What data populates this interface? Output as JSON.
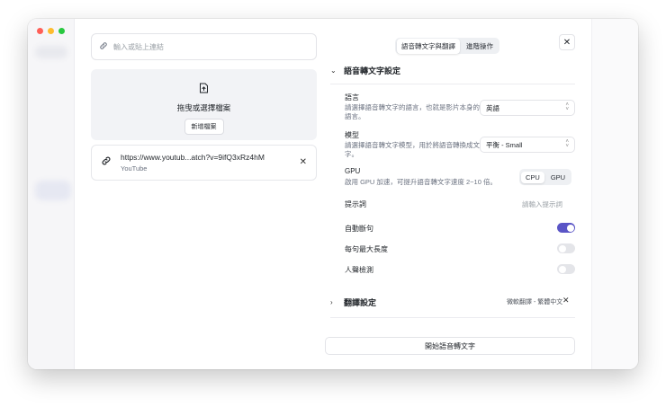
{
  "colors": {
    "accent": "#5a55c6",
    "traffic_red": "#ff5f57",
    "traffic_yellow": "#febc2e",
    "traffic_green": "#28c840"
  },
  "source": {
    "url_placeholder": "輸入或貼上連結",
    "dropzone_label": "拖曳或選擇檔案",
    "add_file_button": "新增檔案",
    "item": {
      "url": "https://www.youtub...atch?v=9ifQ3xRz4hM",
      "source": "YouTube"
    }
  },
  "tabs": [
    {
      "label": "語音轉文字與翻譯",
      "active": true
    },
    {
      "label": "進階操作",
      "active": false
    }
  ],
  "transcription": {
    "title": "語音轉文字設定",
    "language": {
      "label": "語言",
      "description": "請選擇語音轉文字的語言，也就是影片本身的語言。",
      "value": "英語"
    },
    "model": {
      "label": "模型",
      "description": "請選擇語音轉文字模型，用於將語音轉換成文字。",
      "value": "平衡 - Small"
    },
    "gpu": {
      "label": "GPU",
      "description": "啟用 GPU 加速，可提升語音轉文字速度 2~10 倍。",
      "options": [
        "CPU",
        "GPU"
      ],
      "selected": "CPU"
    },
    "prompt": {
      "label": "提示詞",
      "placeholder": "請輸入提示詞"
    },
    "auto_segment": {
      "label": "自動斷句",
      "enabled": true
    },
    "max_length": {
      "label": "每句最大長度",
      "enabled": false
    },
    "voice_detection": {
      "label": "人聲檢測",
      "enabled": false
    }
  },
  "translation": {
    "title": "翻譯設定",
    "summary": "微軟翻譯 - 繁體中文"
  },
  "start_button": "開始語音轉文字"
}
